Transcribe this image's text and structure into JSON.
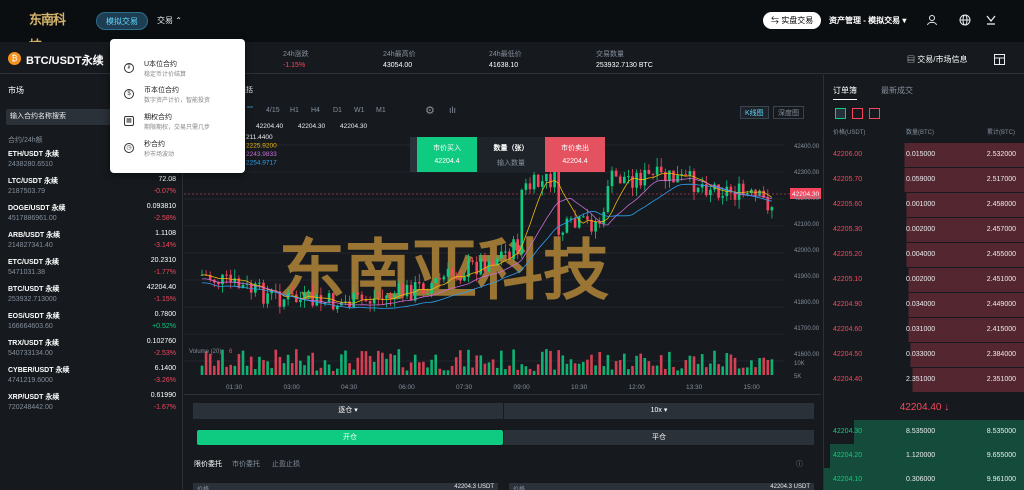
{
  "header": {
    "logo_text": "东南科技",
    "nav_sim": "模拟交易",
    "nav_trade": "交易",
    "real_btn": "实盘交易",
    "asset_menu": "资产管理 - 模拟交易"
  },
  "dropdown": [
    {
      "title": "U本位合约",
      "sub": "稳定币计价结算",
      "icon": "usdt-circle-icon"
    },
    {
      "title": "币本位合约",
      "sub": "数字资产计价，智能投资",
      "icon": "dollar-circle-icon"
    },
    {
      "title": "期权合约",
      "sub": "期限期权，交易只需几步",
      "icon": "calendar-icon"
    },
    {
      "title": "秒合约",
      "sub": "秒市场波动",
      "icon": "clock-icon"
    }
  ],
  "ticker": {
    "pair": "BTC/USDT永续",
    "change_label": "24h涨跌",
    "change_value": "-1.15%",
    "high_label": "24h最高价",
    "high_value": "43054.00",
    "low_label": "24h最低价",
    "low_value": "41638.10",
    "vol_label": "交易数量",
    "vol_value": "253932.7130 BTC",
    "trade_info": "交易/市场信息"
  },
  "market": {
    "title": "市场",
    "search_placeholder": "输入合约名称搜索",
    "col_head": "合约/24h额",
    "rows": [
      {
        "name": "ETH/USDT 永续",
        "vol": "2438280.6510",
        "price": "",
        "change": "",
        "dir": "neg"
      },
      {
        "name": "LTC/USDT 永续",
        "vol": "2187503.79",
        "price": "72.08",
        "change": "-0.07%",
        "dir": "neg"
      },
      {
        "name": "DOGE/USDT 永续",
        "vol": "4517886961.00",
        "price": "0.093810",
        "change": "-2.58%",
        "dir": "neg"
      },
      {
        "name": "ARB/USDT 永续",
        "vol": "214827341.40",
        "price": "1.1108",
        "change": "-3.14%",
        "dir": "neg"
      },
      {
        "name": "ETC/USDT 永续",
        "vol": "5471031.38",
        "price": "20.2310",
        "change": "-1.77%",
        "dir": "neg"
      },
      {
        "name": "BTC/USDT 永续",
        "vol": "253932.713000",
        "price": "42204.40",
        "change": "-1.15%",
        "dir": "neg"
      },
      {
        "name": "EOS/USDT 永续",
        "vol": "166664603.60",
        "price": "0.7800",
        "change": "+0.52%",
        "dir": "pos"
      },
      {
        "name": "TRX/USDT 永续",
        "vol": "540733134.00",
        "price": "0.102760",
        "change": "-2.53%",
        "dir": "neg"
      },
      {
        "name": "CYBER/USDT 永续",
        "vol": "4741219.6000",
        "price": "6.1400",
        "change": "-3.26%",
        "dir": "neg"
      },
      {
        "name": "XRP/USDT 永续",
        "vol": "720248442.00",
        "price": "0.61990",
        "change": "-1.67%",
        "dir": "neg"
      }
    ]
  },
  "chart": {
    "tab_label": "市概括",
    "timeframes": [
      "4/15",
      "H1",
      "H4",
      "D1",
      "W1",
      "M1"
    ],
    "active_tf": "",
    "ohlc": [
      "42204.40",
      "42204.40",
      "42204.30",
      "42204.30"
    ],
    "ma": [
      "211.4400",
      "2225.9200",
      "2243.9833",
      "2254.9717"
    ],
    "kline_btn": "K线图",
    "depth_btn": "深度图",
    "y_ticks": [
      "42400.00",
      "42300.00",
      "42200.00",
      "42100.00",
      "42000.00",
      "41900.00",
      "41800.00",
      "41700.00",
      "41600.00"
    ],
    "current_price": "42204.30",
    "x_ticks": [
      "01:30",
      "03:00",
      "04:30",
      "06:00",
      "07:30",
      "09:00",
      "10:30",
      "12:00",
      "13:30",
      "15:00"
    ],
    "volume_label": "Volume (20)",
    "volume_val": "6",
    "vol_ticks": [
      "10K",
      "5K"
    ],
    "watermark": "东南亚科技"
  },
  "order_card": {
    "buy_label": "市价买入",
    "buy_price": "42204.4",
    "qty_label": "数量（张）",
    "qty_placeholder": "输入数量",
    "sell_label": "市价卖出",
    "sell_price": "42204.4"
  },
  "trade_panel": {
    "mode": "逐仓",
    "leverage": "10x",
    "open": "开仓",
    "close": "平仓",
    "tabs": [
      "限价委托",
      "市价委托",
      "止盈止损"
    ],
    "field1_label": "价格",
    "field1_value": "42204.3 USDT",
    "field2_label": "价格",
    "field2_value": "42204.3 USDT"
  },
  "orderbook": {
    "tab1": "订单簿",
    "tab2": "最新成交",
    "h_price": "价格(USDT)",
    "h_qty": "数量(BTC)",
    "h_total": "累计(BTC)",
    "asks": [
      [
        "42206.00",
        "0.015000",
        "2.532000"
      ],
      [
        "42205.70",
        "0.059000",
        "2.517000"
      ],
      [
        "42205.60",
        "0.001000",
        "2.458000"
      ],
      [
        "42205.30",
        "0.002000",
        "2.457000"
      ],
      [
        "42205.20",
        "0.004000",
        "2.455000"
      ],
      [
        "42205.10",
        "0.002000",
        "2.451000"
      ],
      [
        "42204.90",
        "0.034000",
        "2.449000"
      ],
      [
        "42204.60",
        "0.031000",
        "2.415000"
      ],
      [
        "42204.50",
        "0.033000",
        "2.384000"
      ],
      [
        "42204.40",
        "2.351000",
        "2.351000"
      ]
    ],
    "last": "42204.40 ↓",
    "bids": [
      [
        "42204.30",
        "8.535000",
        "8.535000"
      ],
      [
        "42204.20",
        "1.120000",
        "9.655000"
      ],
      [
        "42204.10",
        "0.306000",
        "9.961000"
      ]
    ]
  },
  "colors": {
    "up": "#0ecb81",
    "down": "#f6465d",
    "accent": "#5fd7ff"
  }
}
